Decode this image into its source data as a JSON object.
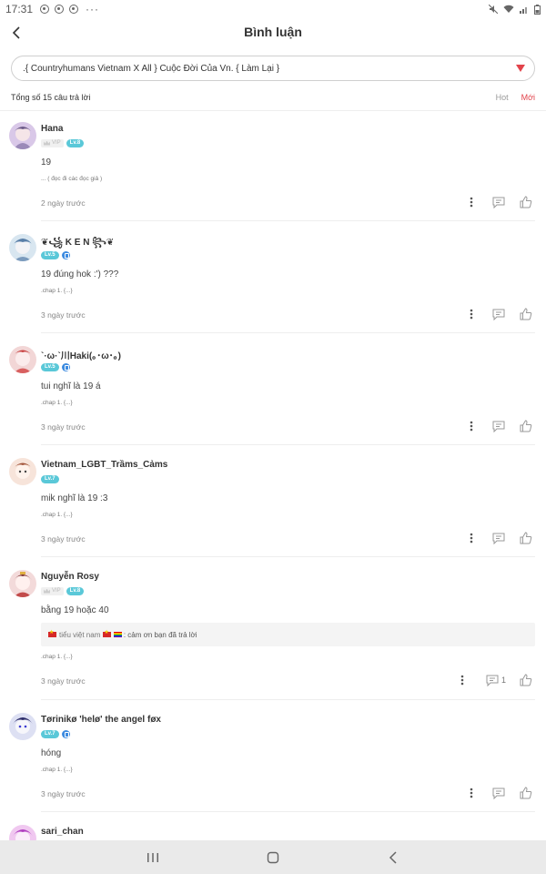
{
  "status_bar": {
    "time": "17:31",
    "more": "···"
  },
  "header": {
    "title": "Bình luận"
  },
  "chapter_selector": {
    "value": ".{ Countryhumans Vietnam X All } Cuộc Đời Của Vn. { Làm Lại }"
  },
  "totals": {
    "count_label": "Tổng số 15 câu trả lời",
    "sort_hot": "Hot",
    "sort_new": "Mới"
  },
  "colors": {
    "accent": "#e2434b",
    "level_badge": "#5ac8d8",
    "verified": "#3d8be0"
  },
  "comments": [
    {
      "name": "Hana",
      "vip": "VIP",
      "level": "Lv.8",
      "text": "19",
      "chapter": "... ( đọc đi các đọc giả )",
      "time": "2 ngày trước"
    },
    {
      "name": "❦꧁ K E N ꧂❦",
      "level": "Lv.5",
      "text": "19 đúng hok :') ???",
      "chapter": ".chap 1. {...}",
      "time": "3 ngày trước"
    },
    {
      "name": "`·ω·`川Haki(｡･ω･｡)",
      "level": "Lv.5",
      "text": "tui nghĩ là 19 á",
      "chapter": ".chap 1. {...}",
      "time": "3 ngày trước"
    },
    {
      "name": "Vietnam_LGBT_Trầms_Cảms",
      "level": "Lv.7",
      "text": "mik nghĩ là 19 :3",
      "chapter": ".chap 1. {...}",
      "time": "3 ngày trước"
    },
    {
      "name": "Nguyễn Rosy",
      "vip": "VIP",
      "level": "Lv.8",
      "text": "bằng 19 hoặc 40",
      "reply_author": "tiểu việt nam",
      "reply_text": ": cảm ơn bạn đã trả lời",
      "chapter": ".chap 1. {...}",
      "time": "3 ngày trước",
      "reply_count": "1"
    },
    {
      "name": "Tørinikø 'helø' the angel føx",
      "level": "Lv.7",
      "text": "hóng",
      "chapter": ".chap 1. {...}",
      "time": "3 ngày trước"
    },
    {
      "name": "sari_chan"
    }
  ],
  "icons": {
    "back": "chevron-left-icon",
    "dropdown": "caret-down-icon",
    "more": "more-vertical-icon",
    "reply": "comment-icon",
    "like": "thumbs-up-icon",
    "nav_recent": "recent-apps-icon",
    "nav_home": "home-icon",
    "nav_back": "nav-back-icon"
  }
}
